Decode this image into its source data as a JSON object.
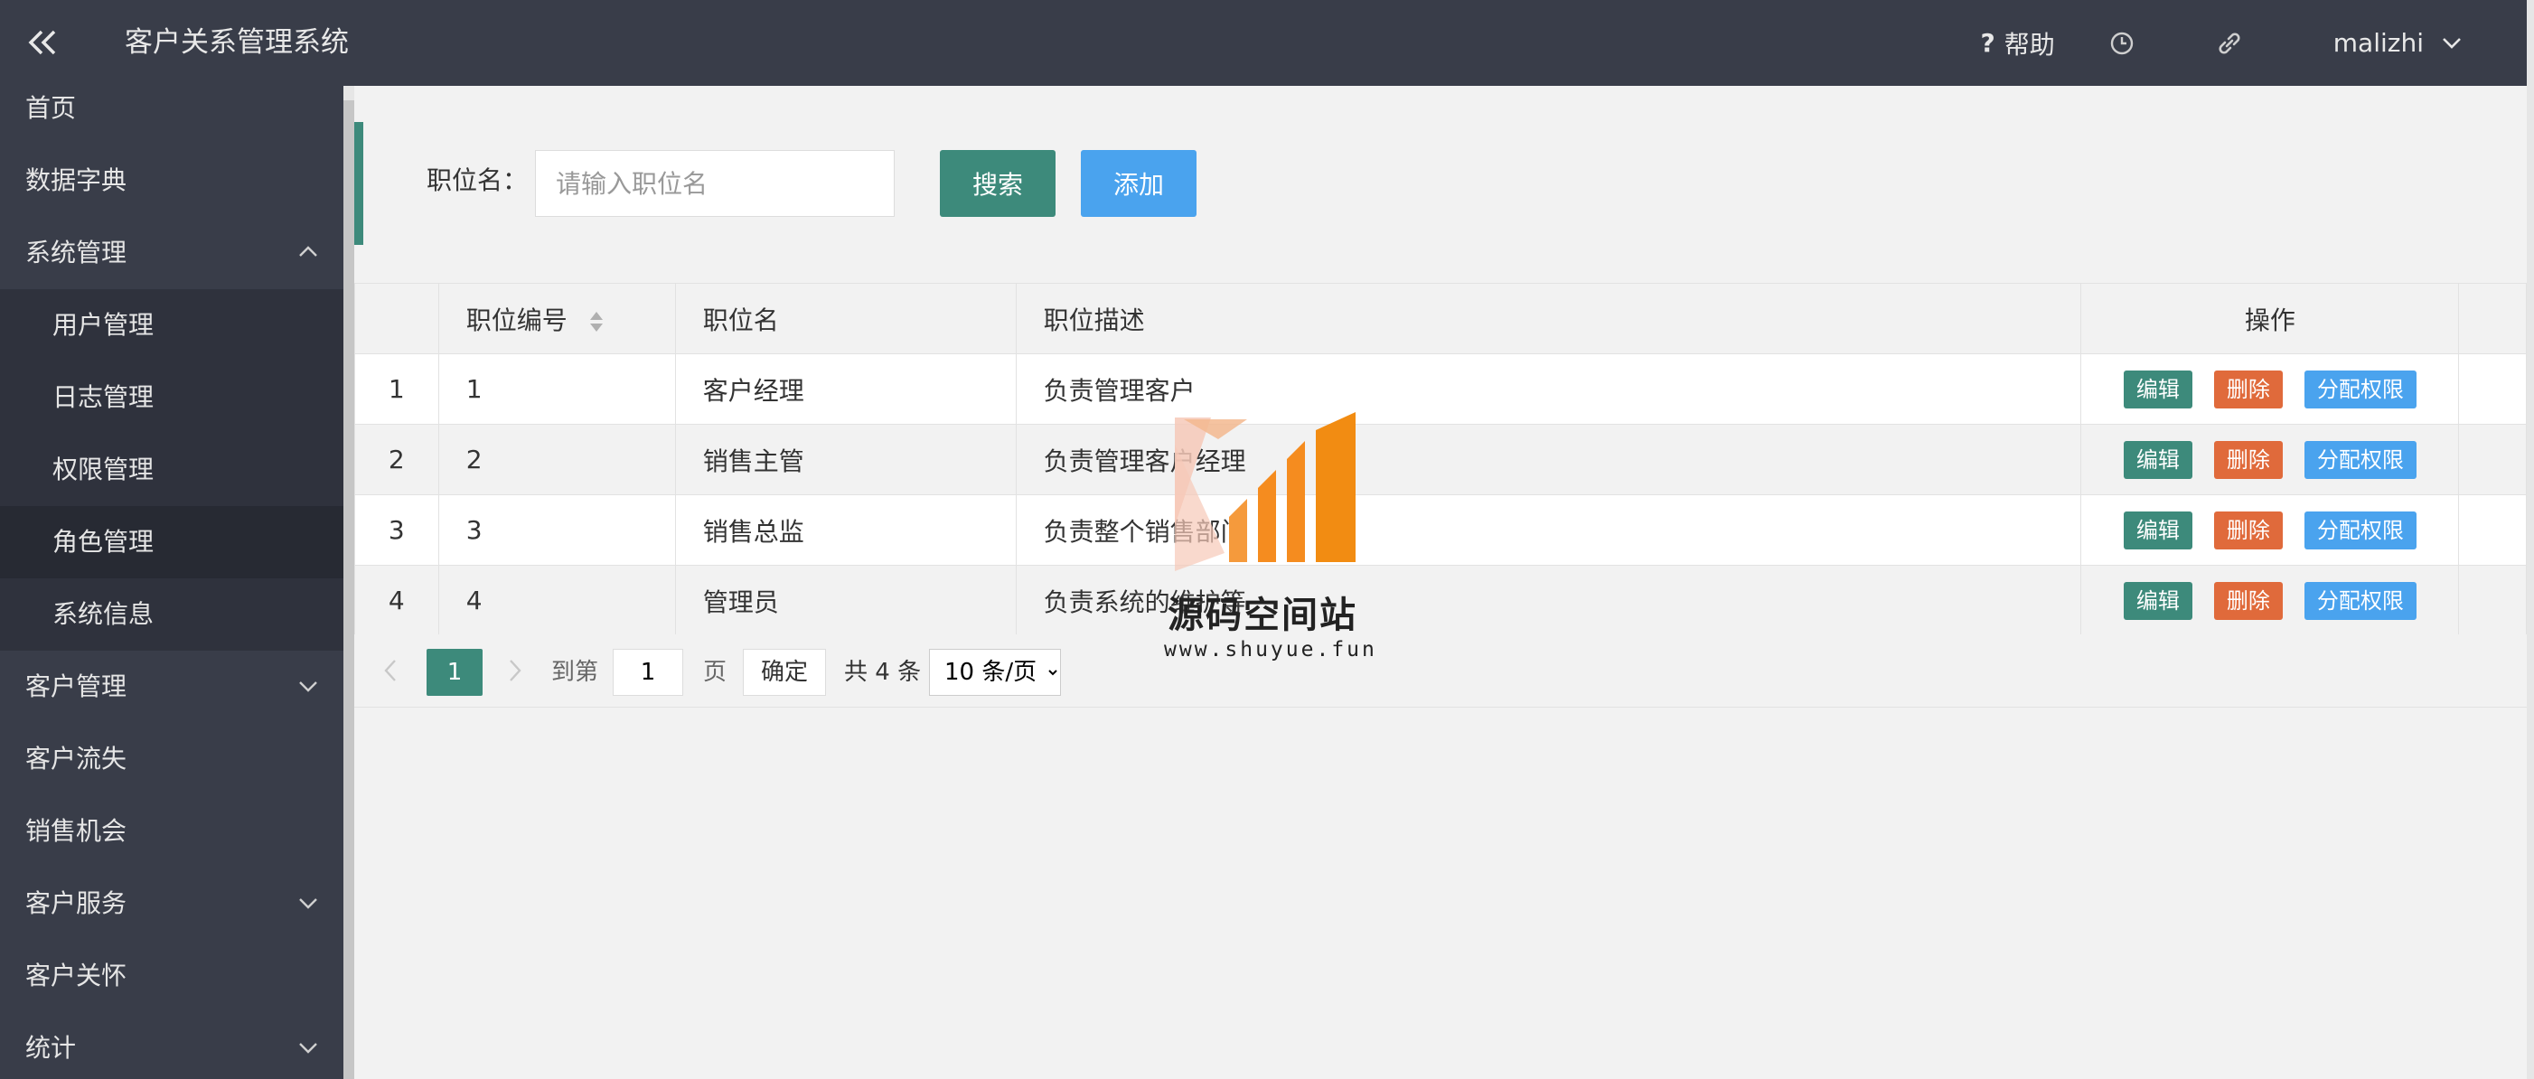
{
  "header": {
    "title": "客户关系管理系统",
    "help_label": "帮助",
    "user_name": "malizhi"
  },
  "sidebar": {
    "items": [
      {
        "label": "首页"
      },
      {
        "label": "数据字典"
      },
      {
        "label": "系统管理"
      },
      {
        "label": "用户管理"
      },
      {
        "label": "日志管理"
      },
      {
        "label": "权限管理"
      },
      {
        "label": "角色管理"
      },
      {
        "label": "系统信息"
      },
      {
        "label": "客户管理"
      },
      {
        "label": "客户流失"
      },
      {
        "label": "销售机会"
      },
      {
        "label": "客户服务"
      },
      {
        "label": "客户关怀"
      },
      {
        "label": "统计"
      }
    ]
  },
  "search": {
    "label": "职位名：",
    "placeholder": "请输入职位名",
    "search_label": "搜索",
    "add_label": "添加"
  },
  "table": {
    "columns": [
      "职位编号",
      "职位名",
      "职位描述",
      "操作"
    ],
    "rows": [
      {
        "index": "1",
        "id": "1",
        "name": "客户经理",
        "desc": "负责管理客户"
      },
      {
        "index": "2",
        "id": "2",
        "name": "销售主管",
        "desc": "负责管理客户经理"
      },
      {
        "index": "3",
        "id": "3",
        "name": "销售总监",
        "desc": "负责整个销售部门"
      },
      {
        "index": "4",
        "id": "4",
        "name": "管理员",
        "desc": "负责系统的维护等"
      }
    ],
    "actions": {
      "edit": "编辑",
      "delete": "删除",
      "assign": "分配权限"
    }
  },
  "pager": {
    "current": "1",
    "goto_label": "到第",
    "goto_value": "1",
    "page_unit": "页",
    "confirm": "确定",
    "total": "共 4 条",
    "page_size": "10 条/页"
  },
  "watermark": {
    "title": "源码空间站",
    "url": "www.shuyue.fun"
  },
  "colors": {
    "topbar": "#393d49",
    "primary": "#3d8a7b",
    "danger": "#e06a3b",
    "info": "#4aa3ee"
  }
}
